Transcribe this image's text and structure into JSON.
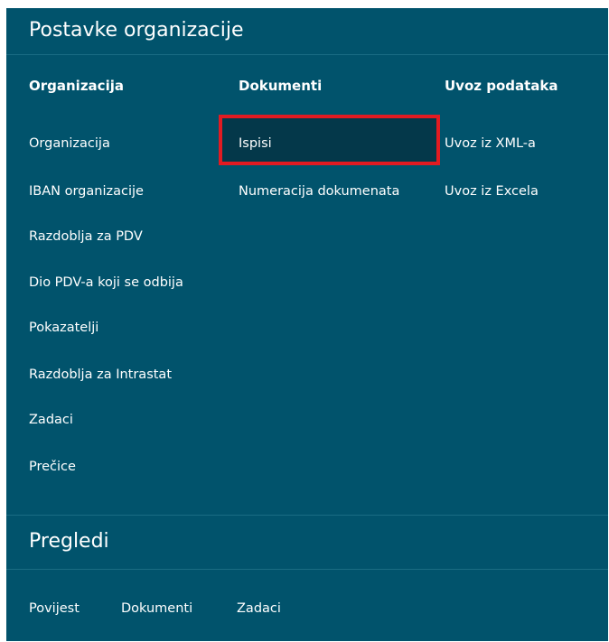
{
  "settings": {
    "title": "Postavke organizacije",
    "columns": [
      {
        "heading": "Organizacija",
        "items": [
          "Organizacija",
          "IBAN organizacije",
          "Razdoblja za PDV",
          "Dio PDV-a koji se odbija",
          "Pokazatelji",
          "Razdoblja za Intrastat",
          "Zadaci",
          "Prečice"
        ]
      },
      {
        "heading": "Dokumenti",
        "items": [
          "Ispisi",
          "Numeracija dokumenata"
        ]
      },
      {
        "heading": "Uvoz podataka",
        "items": [
          "Uvoz iz XML-a",
          "Uvoz iz Excela"
        ]
      }
    ],
    "selected_item": "Ispisi"
  },
  "reviews": {
    "title": "Pregledi",
    "items": [
      "Povijest",
      "Dokumenti",
      "Zadaci"
    ]
  },
  "colors": {
    "panel_bg": "#01536c",
    "selected_bg": "#04384a",
    "highlight_border": "#e21b22",
    "text": "#ffffff"
  }
}
